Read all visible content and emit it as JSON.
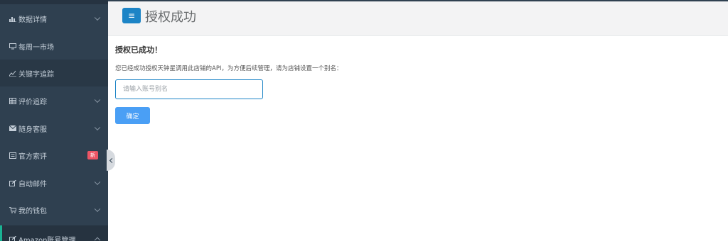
{
  "sidebar": {
    "items": [
      {
        "label": "数据详情",
        "icon": "bar-chart-icon",
        "expandable": true
      },
      {
        "label": "每周一市场",
        "icon": "monitor-icon",
        "expandable": false
      },
      {
        "label": "关键字追踪",
        "icon": "line-chart-icon",
        "expandable": false
      },
      {
        "label": "评价追踪",
        "icon": "table-icon",
        "expandable": true
      },
      {
        "label": "随身客服",
        "icon": "envelope-icon",
        "expandable": true
      },
      {
        "label": "官方索评",
        "icon": "list-icon",
        "expandable": false,
        "badge": "新"
      },
      {
        "label": "自动邮件",
        "icon": "edit-icon",
        "expandable": true
      },
      {
        "label": "我的钱包",
        "icon": "cart-icon",
        "expandable": true
      },
      {
        "label": "Amazon账号管理",
        "icon": "edit-icon",
        "expandable": true
      }
    ]
  },
  "header": {
    "menu_icon": "hamburger-icon",
    "title": "授权成功"
  },
  "main": {
    "heading": "授权已成功！",
    "description": "您已经成功授权天钟星调用此店铺的API，为方便后续管理，请为店铺设置一个别名：",
    "alias_input": {
      "placeholder": "请输入账号别名",
      "value": ""
    },
    "confirm_label": "确定"
  },
  "colors": {
    "sidebar_bg": "#2f4050",
    "accent_blue": "#1c84c6",
    "button_blue": "#4a9ff5",
    "badge_red": "#ed5565"
  }
}
